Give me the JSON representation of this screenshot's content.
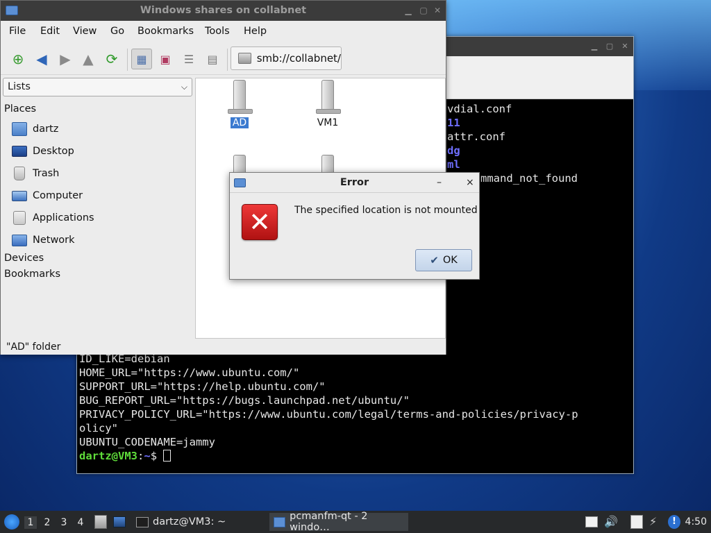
{
  "terminal": {
    "lines_top": [
      {
        "text": "vdial.conf",
        "style": "normal"
      },
      {
        "text": "11",
        "style": "blue"
      },
      {
        "text": "attr.conf",
        "style": "normal"
      },
      {
        "text": "dg",
        "style": "blue"
      },
      {
        "text": "ml",
        "style": "blue"
      },
      {
        "text": "mmand_not_found",
        "style": "normal"
      }
    ],
    "lines_bottom": [
      "ID_LIKE=debian",
      "HOME_URL=\"https://www.ubuntu.com/\"",
      "SUPPORT_URL=\"https://help.ubuntu.com/\"",
      "BUG_REPORT_URL=\"https://bugs.launchpad.net/ubuntu/\"",
      "PRIVACY_POLICY_URL=\"https://www.ubuntu.com/legal/terms-and-policies/privacy-p",
      "olicy\"",
      "UBUNTU_CODENAME=jammy"
    ],
    "prompt_user": "dartz@VM3",
    "prompt_colon": ":",
    "prompt_path": "~",
    "prompt_symbol": "$"
  },
  "file_manager": {
    "title": "Windows shares on collabnet",
    "menu": [
      "File",
      "Edit",
      "View",
      "Go",
      "Bookmarks",
      "Tools",
      "Help"
    ],
    "path": "smb://collabnet/",
    "side_select": "Lists",
    "places_heading": "Places",
    "places": [
      {
        "label": "dartz",
        "icon": "home-folder-icon"
      },
      {
        "label": "Desktop",
        "icon": "desktop-icon"
      },
      {
        "label": "Trash",
        "icon": "trash-icon"
      },
      {
        "label": "Computer",
        "icon": "computer-icon"
      },
      {
        "label": "Applications",
        "icon": "applications-icon"
      },
      {
        "label": "Network",
        "icon": "network-icon"
      }
    ],
    "devices_heading": "Devices",
    "bookmarks_heading": "Bookmarks",
    "shares": [
      {
        "label": "AD",
        "selected": true
      },
      {
        "label": "VM1",
        "selected": false
      }
    ],
    "status": "\"AD\" folder"
  },
  "dialog": {
    "title": "Error",
    "message": "The specified location is not mounted",
    "ok_label": "OK",
    "minimize_glyph": "–",
    "close_glyph": "×"
  },
  "taskbar": {
    "desktops": [
      "1",
      "2",
      "3",
      "4"
    ],
    "active_desktop": "1",
    "tasks": [
      {
        "label": "dartz@VM3: ~",
        "icon": "terminal-icon",
        "active": false
      },
      {
        "label": "pcmanfm-qt - 2 windo…",
        "icon": "folder-icon",
        "active": true
      }
    ],
    "clock": "4:50"
  }
}
